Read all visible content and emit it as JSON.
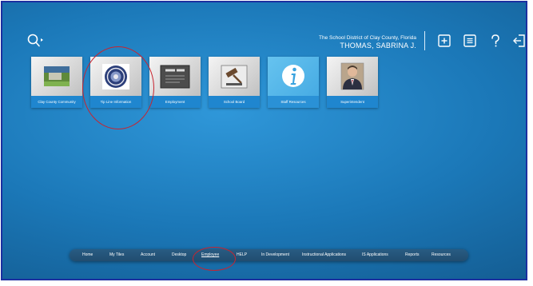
{
  "header": {
    "org_name": "The School District of Clay County, Florida",
    "user_name": "THOMAS, SABRINA J.",
    "icons": [
      "search-icon",
      "add-tile-icon",
      "list-icon",
      "help-icon",
      "sign-out-icon"
    ]
  },
  "tiles": [
    {
      "label": "Clay County Community",
      "icon": "community-image"
    },
    {
      "label": "Tip Line Information",
      "icon": "seal-icon"
    },
    {
      "label": "Employment",
      "icon": "jobs-image"
    },
    {
      "label": "School Board",
      "icon": "gavel-icon"
    },
    {
      "label": "Staff Resources",
      "icon": "info-icon"
    },
    {
      "label": "Superintendent",
      "icon": "portrait-image"
    }
  ],
  "nav": {
    "items": [
      "Home",
      "My Tiles",
      "Account",
      "Desktop",
      "Employee",
      "HELP",
      "In Development",
      "Instructional Applications",
      "IS Applications",
      "Reports",
      "Resources"
    ],
    "active": "Employee"
  },
  "colors": {
    "frame_border": "#1c2fa0",
    "background": "#1b78b8",
    "tile_label": "#1f86cf",
    "annotation": "#c8242f"
  }
}
